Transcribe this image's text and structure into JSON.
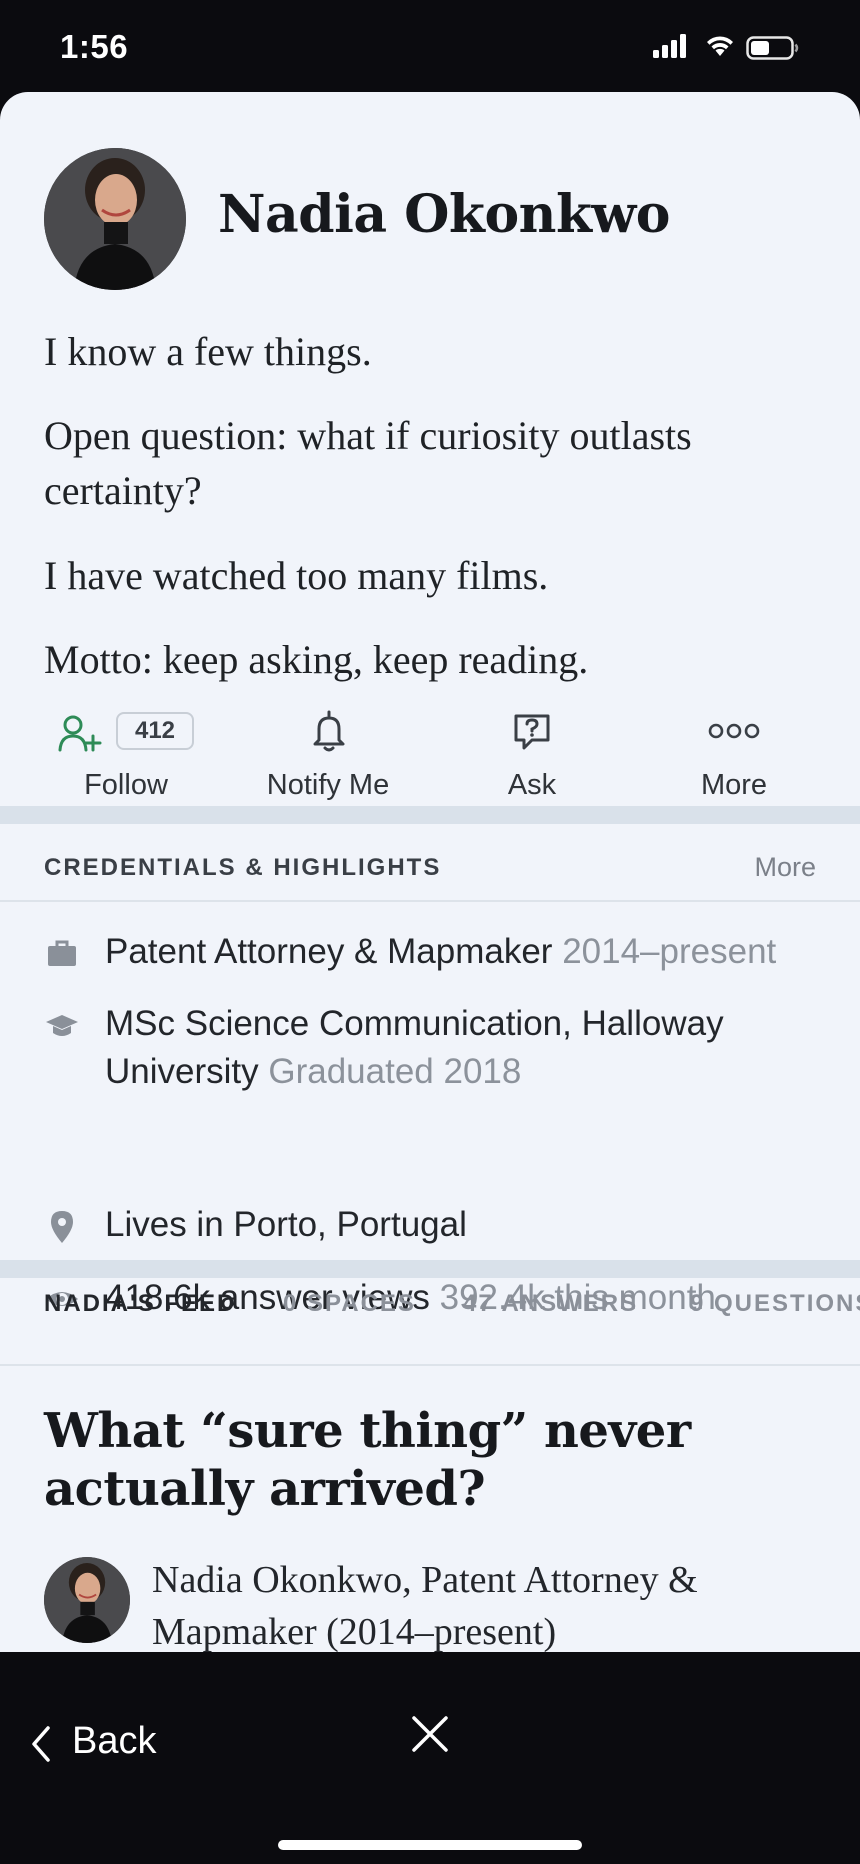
{
  "status_bar": {
    "time": "1:56"
  },
  "profile": {
    "name": "Nadia Okonkwo",
    "bio": [
      "I know a few things.",
      "Open question: what if curiosity outlasts certainty?",
      "I have watched too many films.",
      "Motto: keep asking, keep reading."
    ]
  },
  "actions": {
    "follow_label": "Follow",
    "follow_count": "412",
    "notify_label": "Notify Me",
    "ask_label": "Ask",
    "more_label": "More"
  },
  "credentials": {
    "title": "CREDENTIALS & HIGHLIGHTS",
    "more": "More",
    "items": [
      {
        "icon": "briefcase-icon",
        "main": "Patent Attorney & Mapmaker",
        "sub": "2014–present"
      },
      {
        "icon": "graduation-cap-icon",
        "main": "MSc Science Communication, Halloway University",
        "sub": "Graduated 2018"
      },
      {
        "icon": "location-pin-icon",
        "main": "Lives in Porto, Portugal",
        "sub": ""
      },
      {
        "icon": "eye-icon",
        "main": "418.6k answer views",
        "sub": "392.4k this month"
      }
    ]
  },
  "tabs": [
    "NADIA'S FEED",
    "0 SPACES",
    "47 ANSWERS",
    "9 QUESTIONS"
  ],
  "feed": {
    "question": "What “sure thing” never actually arrived?",
    "author_line": "Nadia Okonkwo, Patent Attorney & Mapmaker (2014–present)"
  },
  "nav": {
    "back_label": "Back"
  },
  "colors": {
    "follow_accent": "#2e8b57",
    "card_bg": "#f1f4fa",
    "separator": "#d9e1ea"
  }
}
